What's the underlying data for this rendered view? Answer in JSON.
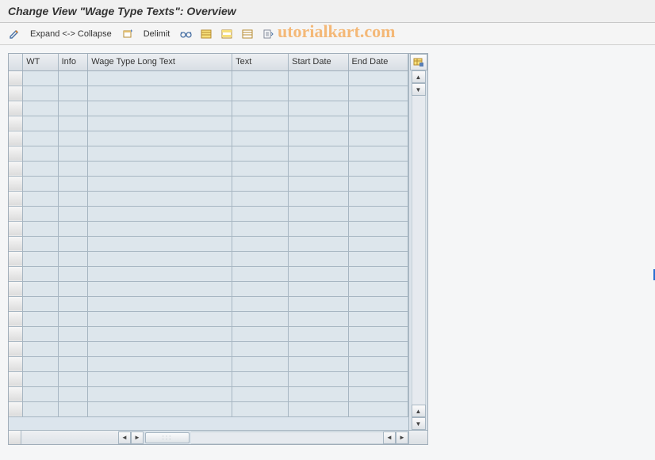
{
  "title": "Change View \"Wage Type Texts\": Overview",
  "toolbar": {
    "expand_collapse_label": "Expand <-> Collapse",
    "delimit_label": "Delimit"
  },
  "watermark": "utorialkart.com",
  "table": {
    "columns": {
      "wt": "WT",
      "info": "Info",
      "long_text": "Wage Type Long Text",
      "text": "Text",
      "start_date": "Start Date",
      "end_date": "End Date"
    },
    "rows": [
      {
        "wt": "",
        "info": "",
        "long_text": "",
        "text": "",
        "start_date": "",
        "end_date": ""
      },
      {
        "wt": "",
        "info": "",
        "long_text": "",
        "text": "",
        "start_date": "",
        "end_date": ""
      },
      {
        "wt": "",
        "info": "",
        "long_text": "",
        "text": "",
        "start_date": "",
        "end_date": ""
      },
      {
        "wt": "",
        "info": "",
        "long_text": "",
        "text": "",
        "start_date": "",
        "end_date": ""
      },
      {
        "wt": "",
        "info": "",
        "long_text": "",
        "text": "",
        "start_date": "",
        "end_date": ""
      },
      {
        "wt": "",
        "info": "",
        "long_text": "",
        "text": "",
        "start_date": "",
        "end_date": ""
      },
      {
        "wt": "",
        "info": "",
        "long_text": "",
        "text": "",
        "start_date": "",
        "end_date": ""
      },
      {
        "wt": "",
        "info": "",
        "long_text": "",
        "text": "",
        "start_date": "",
        "end_date": ""
      },
      {
        "wt": "",
        "info": "",
        "long_text": "",
        "text": "",
        "start_date": "",
        "end_date": ""
      },
      {
        "wt": "",
        "info": "",
        "long_text": "",
        "text": "",
        "start_date": "",
        "end_date": ""
      },
      {
        "wt": "",
        "info": "",
        "long_text": "",
        "text": "",
        "start_date": "",
        "end_date": ""
      },
      {
        "wt": "",
        "info": "",
        "long_text": "",
        "text": "",
        "start_date": "",
        "end_date": ""
      },
      {
        "wt": "",
        "info": "",
        "long_text": "",
        "text": "",
        "start_date": "",
        "end_date": ""
      },
      {
        "wt": "",
        "info": "",
        "long_text": "",
        "text": "",
        "start_date": "",
        "end_date": ""
      },
      {
        "wt": "",
        "info": "",
        "long_text": "",
        "text": "",
        "start_date": "",
        "end_date": ""
      },
      {
        "wt": "",
        "info": "",
        "long_text": "",
        "text": "",
        "start_date": "",
        "end_date": ""
      },
      {
        "wt": "",
        "info": "",
        "long_text": "",
        "text": "",
        "start_date": "",
        "end_date": ""
      },
      {
        "wt": "",
        "info": "",
        "long_text": "",
        "text": "",
        "start_date": "",
        "end_date": ""
      },
      {
        "wt": "",
        "info": "",
        "long_text": "",
        "text": "",
        "start_date": "",
        "end_date": ""
      },
      {
        "wt": "",
        "info": "",
        "long_text": "",
        "text": "",
        "start_date": "",
        "end_date": ""
      },
      {
        "wt": "",
        "info": "",
        "long_text": "",
        "text": "",
        "start_date": "",
        "end_date": ""
      },
      {
        "wt": "",
        "info": "",
        "long_text": "",
        "text": "",
        "start_date": "",
        "end_date": ""
      },
      {
        "wt": "",
        "info": "",
        "long_text": "",
        "text": "",
        "start_date": "",
        "end_date": ""
      }
    ]
  }
}
